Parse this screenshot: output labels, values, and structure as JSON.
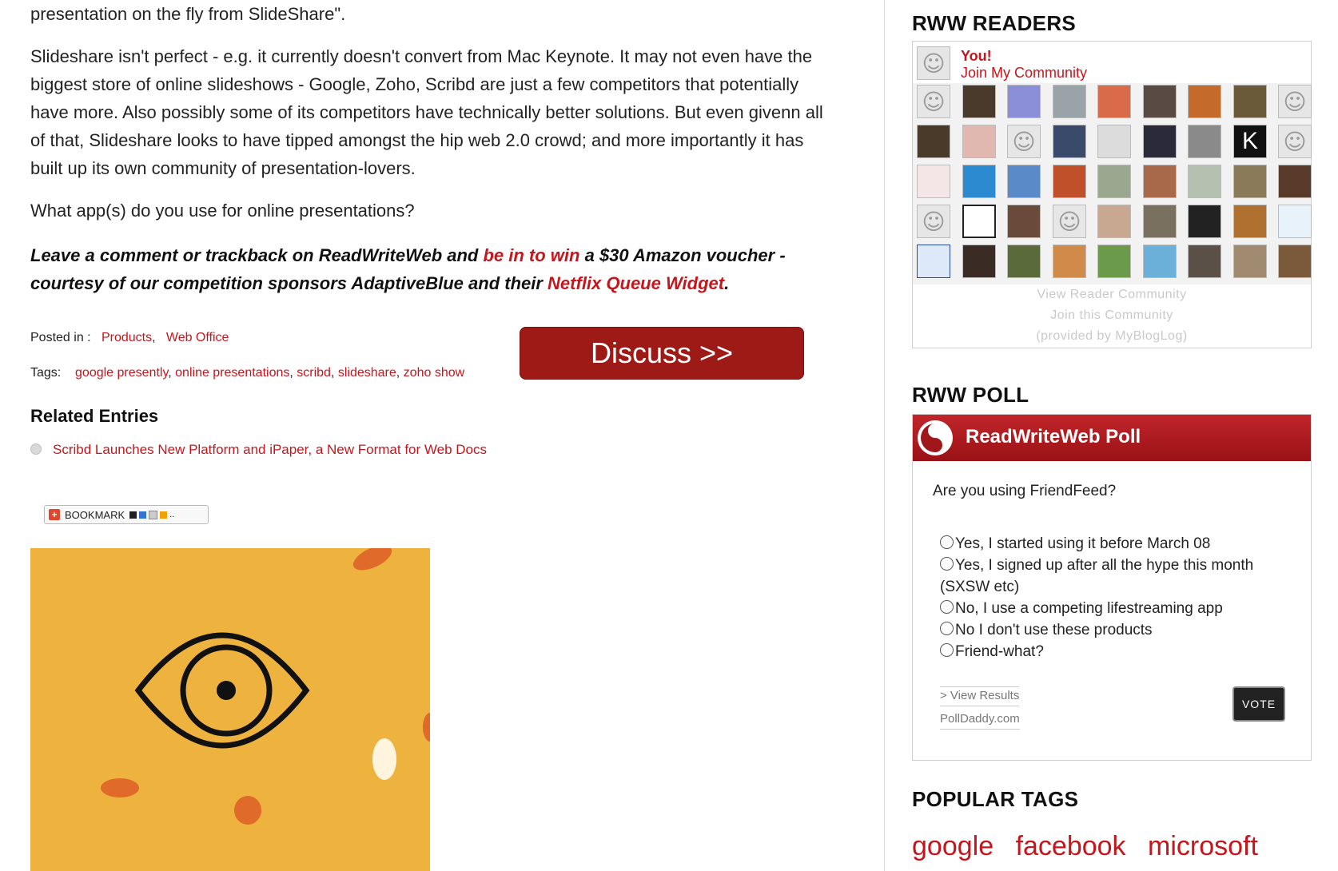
{
  "article": {
    "lead_tail": "presentation on the fly from SlideShare\".",
    "para1": "Slideshare isn't perfect - e.g. it currently doesn't convert from Mac Keynote. It may not even have the biggest store of online slideshows - Google, Zoho, Scribd are just a few competitors that potentially have more. Also possibly some of its competitors have technically better solutions. But even givenn all of that, Slideshare looks to have tipped amongst the hip web 2.0 crowd; and more importantly it has built up its own community of presentation-lovers.",
    "para2": "What app(s) do you use for online presentations?",
    "cta_part1": "Leave a comment or trackback on ReadWriteWeb and ",
    "cta_link1": "be in to win",
    "cta_part2": " a $30 Amazon voucher - courtesy of our competition sponsors AdaptiveBlue and their ",
    "cta_link2": "Netflix Queue Widget",
    "cta_part3": ".",
    "posted_in_label": "Posted in :",
    "categories": [
      "Products",
      "Web Office"
    ],
    "tags_label": "Tags:",
    "tags": [
      "google presently",
      "online presentations",
      "scribd",
      "slideshare",
      "zoho show"
    ],
    "discuss_label": "Discuss >>",
    "related_heading": "Related Entries",
    "related_item": "Scribd Launches New Platform and iPaper, a New Format for Web Docs",
    "bookmark_label": "BOOKMARK"
  },
  "sidebar": {
    "readers_heading": "RWW READERS",
    "you_label": "You!",
    "join_label": "Join My Community",
    "view_community": "View Reader Community",
    "join_community": "Join this Community",
    "provided_by": "(provided by MyBlogLog)",
    "poll_heading": "RWW POLL",
    "poll_title": "ReadWriteWeb Poll",
    "poll_question": "Are you using FriendFeed?",
    "poll_options": [
      "Yes, I started using it before March 08",
      "Yes, I signed up after all the hype this month",
      "(SXSW etc)",
      "No, I use a competing lifestreaming app",
      "No I don't use these products",
      "Friend-what?"
    ],
    "view_results": "> View Results",
    "polldaddy": "PollDaddy.com",
    "vote_label": "VOTE",
    "tags_heading": "POPULAR TAGS",
    "popular_tags": [
      "google",
      "facebook",
      "microsoft"
    ]
  },
  "colors": {
    "link_red": "#c4161c",
    "discuss_bg": "#9e1a16",
    "hero_bg": "#eeb23e",
    "poll_header": "#b01d21"
  }
}
